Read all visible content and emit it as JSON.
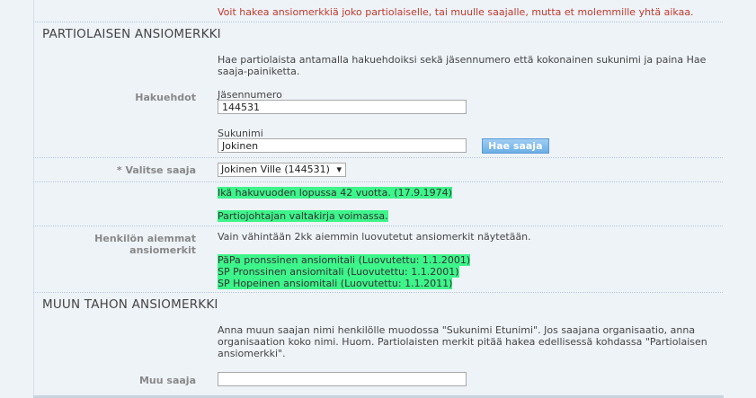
{
  "top_notice": "Voit hakea ansiomerkkiä joko partiolaiselle, tai muulle saajalle, mutta et molemmille yhtä aikaa.",
  "scout_section": {
    "title": "PARTIOLAISEN ANSIOMERKKI",
    "instructions_line1": "Hae partiolaista antamalla hakuehdoiksi sekä jäsennumero että kokonainen sukunimi ja paina Hae",
    "instructions_line2": "saaja-painiketta.",
    "search_label": "Hakuehdot",
    "member_number_label": "Jäsennumero",
    "member_number_value": "144531",
    "surname_label": "Sukunimi",
    "surname_value": "Jokinen",
    "search_button": "Hae saaja",
    "select_label": "* Valitse saaja",
    "select_value": "Jokinen Ville (144531)",
    "select_arrow": "▾",
    "age_info": "Ikä hakuvuoden lopussa 42 vuotta. (17.9.1974)",
    "leader_info": "Partiojohtajan valtakirja voimassa.",
    "previous_label_line1": "Henkilön aiemmat",
    "previous_label_line2": "ansiomerkit",
    "previous_note": "Vain vähintään 2kk aiemmin luovutetut ansiomerkit näytetään.",
    "previous_badges": [
      "PäPa pronssinen ansiomitali (Luovutettu: 1.1.2001)",
      "SP Pronssinen ansiomitali (Luovutettu: 1.1.2001)",
      "SP Hopeinen ansiomitali (Luovutettu: 1.1.2011)"
    ]
  },
  "other_section": {
    "title": "MUUN TAHON ANSIOMERKKI",
    "instructions_line1": "Anna muun saajan nimi henkilölle muodossa \"Sukunimi Etunimi\". Jos saajana organisaatio, anna",
    "instructions_line2": "organisaation koko nimi. Huom. Partiolaisten merkit pitää hakea edellisessä kohdassa \"Partiolaisen",
    "instructions_line3": "ansiomerkki\".",
    "recipient_label": "Muu saaja",
    "recipient_value": ""
  },
  "colors": {
    "warning": "#c0392b",
    "highlight": "#3df58a",
    "button": "#6aaee6"
  }
}
